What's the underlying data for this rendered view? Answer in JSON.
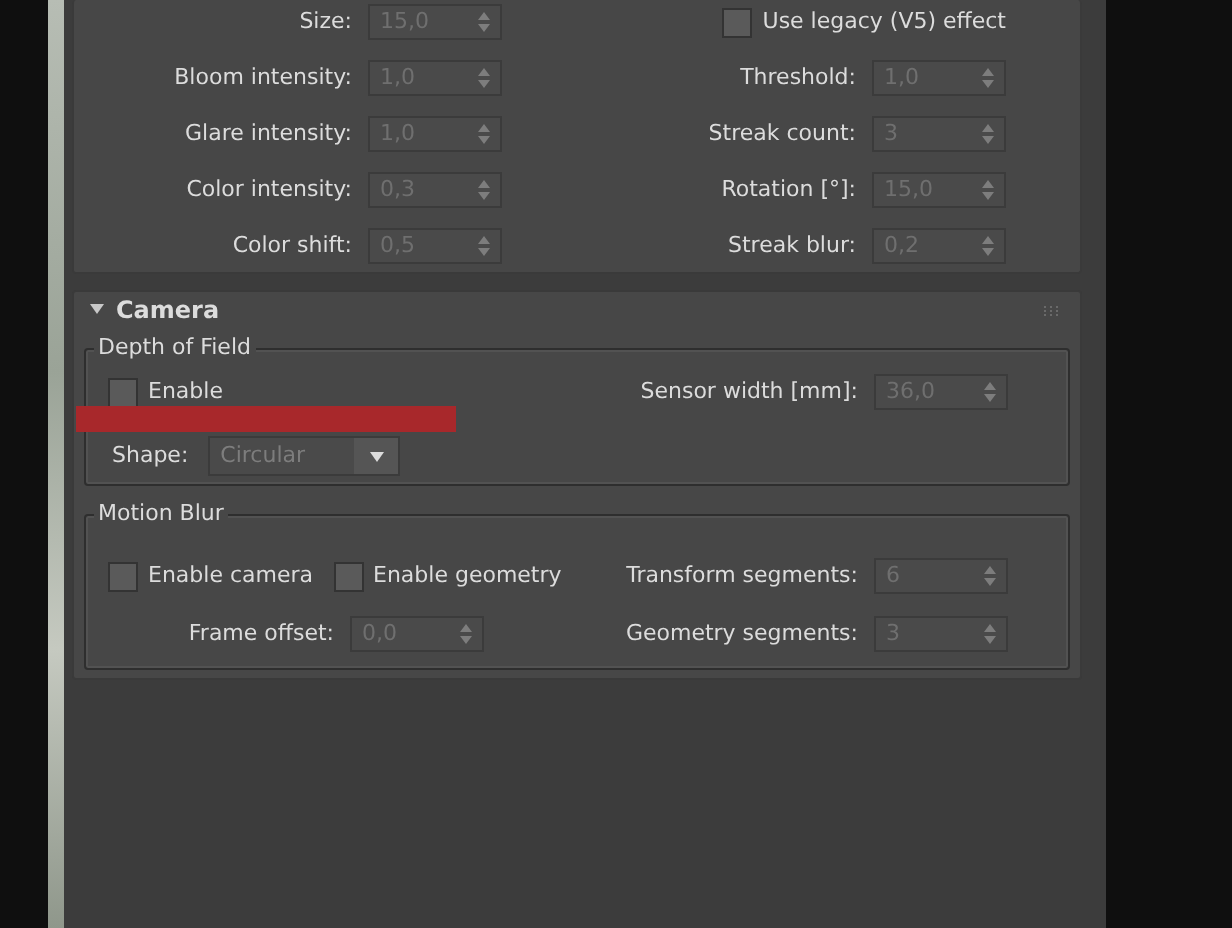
{
  "effects_rollout": {
    "rows": [
      {
        "left": [
          {
            "kind": "spinner",
            "label": "Size:",
            "value": "15,0",
            "disabled": true
          }
        ],
        "right": [
          {
            "kind": "checkbox",
            "label": "Use legacy (V5) effect",
            "checked": false
          }
        ]
      },
      {
        "left": [
          {
            "kind": "spinner",
            "label": "Bloom intensity:",
            "value": "1,0",
            "disabled": true
          }
        ],
        "right": [
          {
            "kind": "spinner",
            "label": "Threshold:",
            "value": "1,0",
            "disabled": true
          }
        ]
      },
      {
        "left": [
          {
            "kind": "spinner",
            "label": "Glare intensity:",
            "value": "1,0",
            "disabled": true
          }
        ],
        "right": [
          {
            "kind": "spinner",
            "label": "Streak count:",
            "value": "3",
            "disabled": true
          }
        ]
      },
      {
        "left": [
          {
            "kind": "spinner",
            "label": "Color intensity:",
            "value": "0,3",
            "disabled": true
          }
        ],
        "right": [
          {
            "kind": "spinner",
            "label": "Rotation [°]:",
            "value": "15,0",
            "disabled": true
          }
        ]
      },
      {
        "left": [
          {
            "kind": "spinner",
            "label": "Color shift:",
            "value": "0,5",
            "disabled": true
          }
        ],
        "right": [
          {
            "kind": "spinner",
            "label": "Streak blur:",
            "value": "0,2",
            "disabled": true
          }
        ]
      }
    ]
  },
  "camera_rollout": {
    "title": "Camera",
    "expanded": true,
    "groups": [
      {
        "title": "Depth of Field",
        "rows": [
          {
            "left": [
              {
                "kind": "checkbox",
                "label": "Enable",
                "checked": false
              }
            ],
            "right": [
              {
                "kind": "spinner",
                "label": "Sensor width [mm]:",
                "value": "36,0",
                "disabled": true
              }
            ]
          },
          {
            "left": [
              {
                "kind": "dropdown",
                "label": "Shape:",
                "value": "Circular",
                "disabled": true
              }
            ],
            "right": []
          }
        ]
      },
      {
        "title": "Motion Blur",
        "rows": [
          {
            "left": [
              {
                "kind": "checkbox",
                "label": "Enable camera",
                "checked": false
              },
              {
                "kind": "checkbox",
                "label": "Enable geometry",
                "checked": false
              }
            ],
            "right": [
              {
                "kind": "spinner",
                "label": "Transform segments:",
                "value": "6",
                "disabled": true
              }
            ]
          },
          {
            "left": [
              {
                "kind": "spinner",
                "label": "Frame offset:",
                "value": "0,0",
                "disabled": true
              }
            ],
            "right": [
              {
                "kind": "spinner",
                "label": "Geometry segments:",
                "value": "3",
                "disabled": true
              }
            ]
          }
        ]
      }
    ]
  }
}
